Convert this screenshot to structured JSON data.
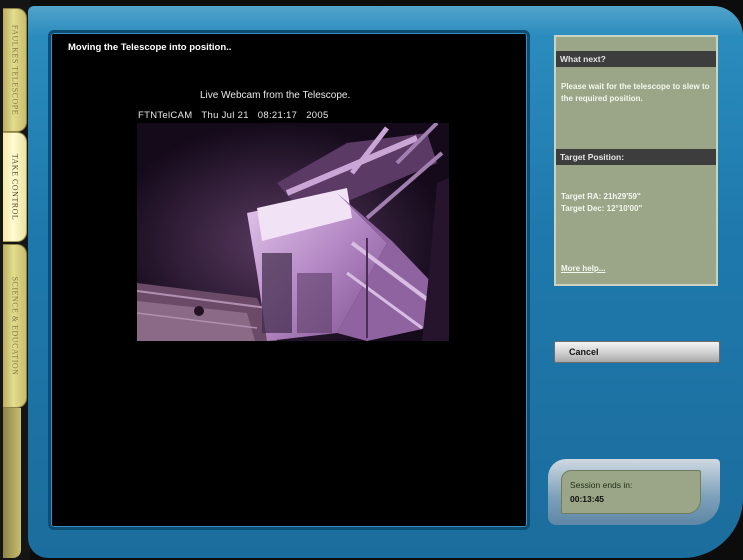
{
  "sidebar": {
    "tabs": [
      {
        "label": "FAULKES TELESCOPE"
      },
      {
        "label": "TAKE CONTROL"
      },
      {
        "label": "SCIENCE & EDUCATION"
      }
    ]
  },
  "main": {
    "status_message": "Moving the Telescope into position..",
    "webcam": {
      "title": "Live Webcam from the Telescope.",
      "camera_name": "FTNTelCAM",
      "date": "Thu Jul 21",
      "time": "08:21:17",
      "year": "2005"
    }
  },
  "info_panel": {
    "what_next_header": "What next?",
    "what_next_text": "Please wait for the telescope to slew to the required position.",
    "target_header": "Target Position:",
    "target_ra": "Target RA: 21h29'59\"",
    "target_dec": "Target Dec: 12°10'00\"",
    "help_link": "More help..."
  },
  "controls": {
    "cancel_label": "Cancel"
  },
  "session": {
    "label": "Session ends in:",
    "time_remaining": "00:13:45"
  },
  "colors": {
    "console_blue": "#2382b6",
    "panel_green": "#9aa687",
    "tab_yellow": "#e4dc8e"
  }
}
